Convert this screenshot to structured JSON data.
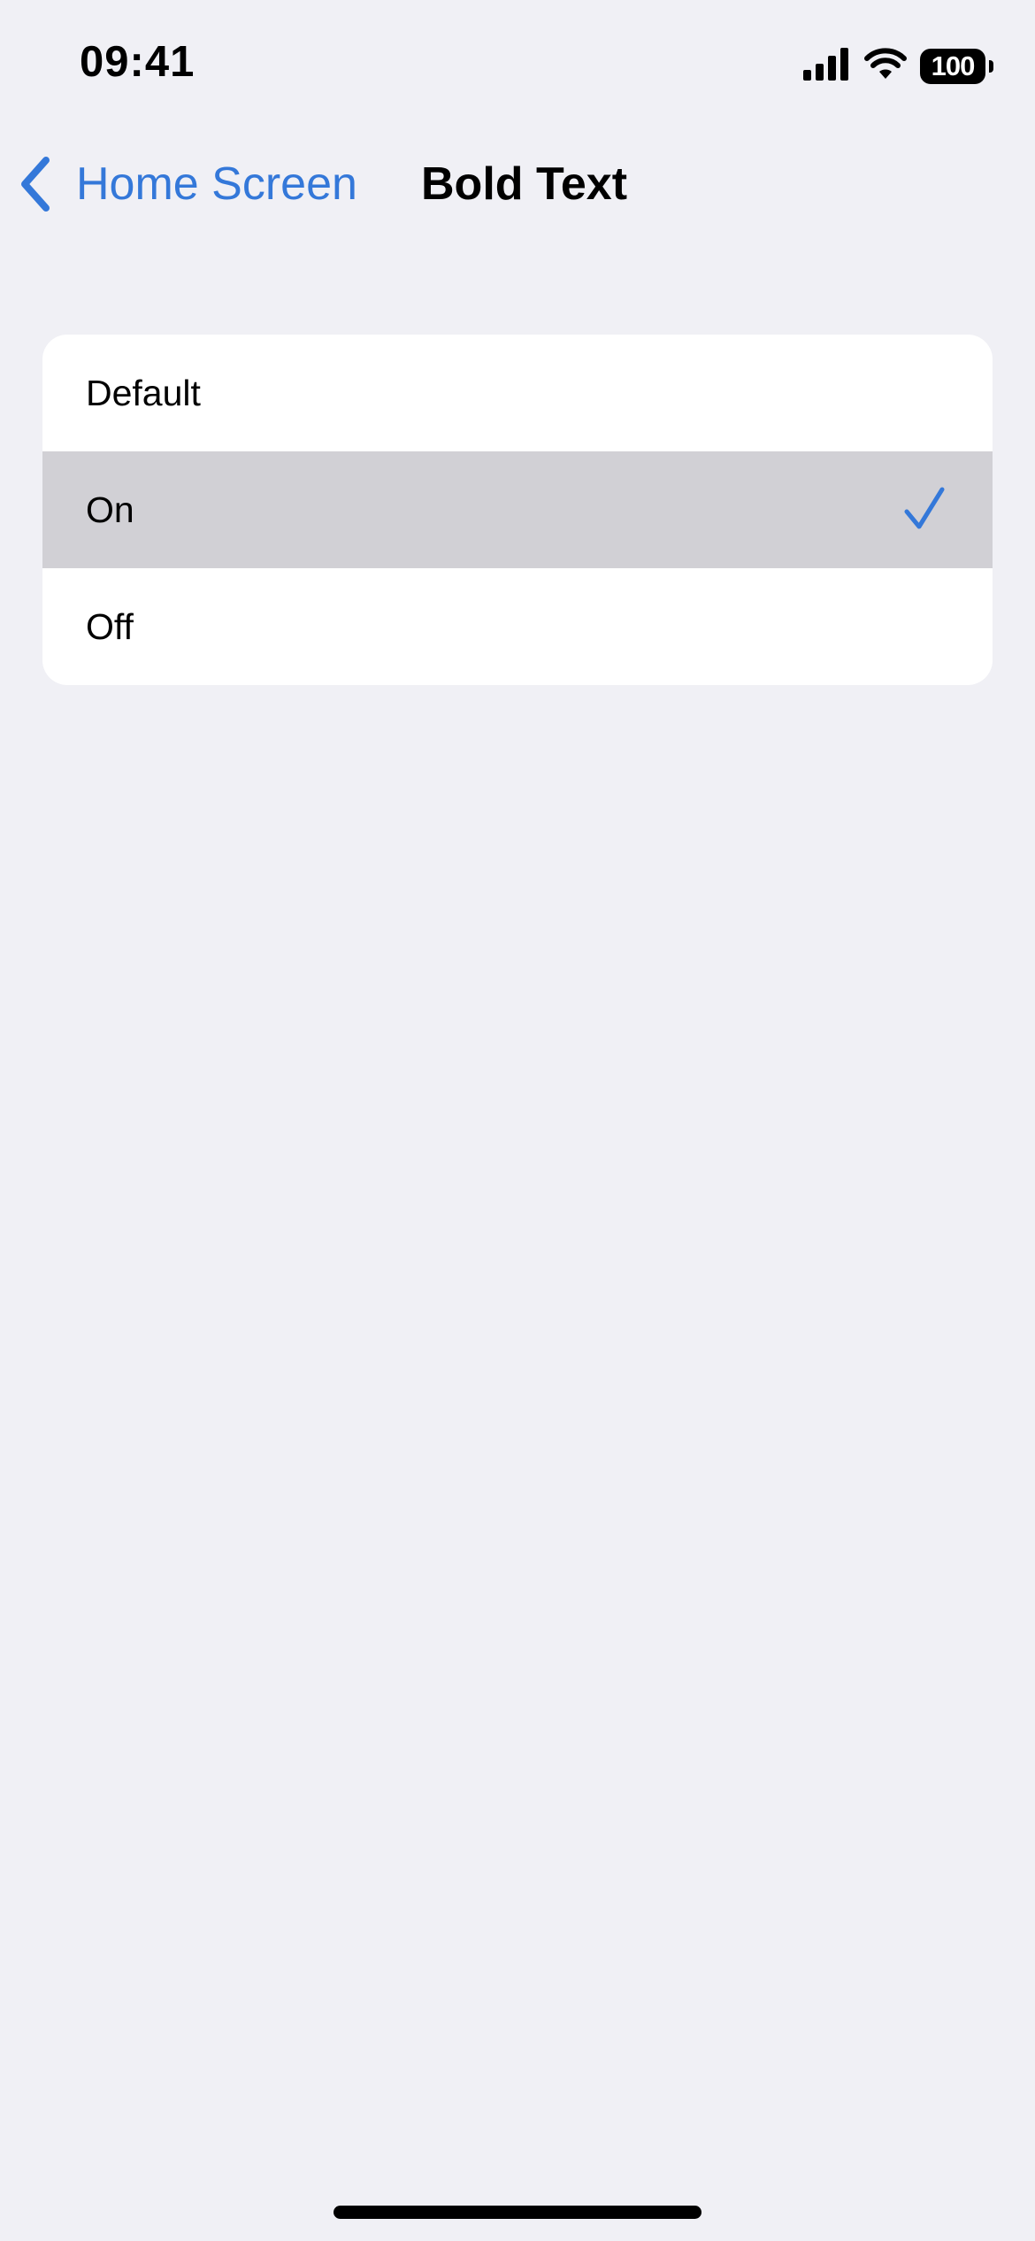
{
  "status_bar": {
    "time": "09:41",
    "battery_level": "100",
    "icons": [
      "cellular-signal-icon",
      "wifi-icon",
      "battery-icon"
    ]
  },
  "nav": {
    "back_label": "Home Screen",
    "title": "Bold Text"
  },
  "options": [
    {
      "label": "Default",
      "selected": false
    },
    {
      "label": "On",
      "selected": true
    },
    {
      "label": "Off",
      "selected": false
    }
  ],
  "colors": {
    "accent": "#3478d9",
    "background": "#f0f0f5",
    "selected_row": "#d1d0d5",
    "group_background": "#ffffff"
  }
}
